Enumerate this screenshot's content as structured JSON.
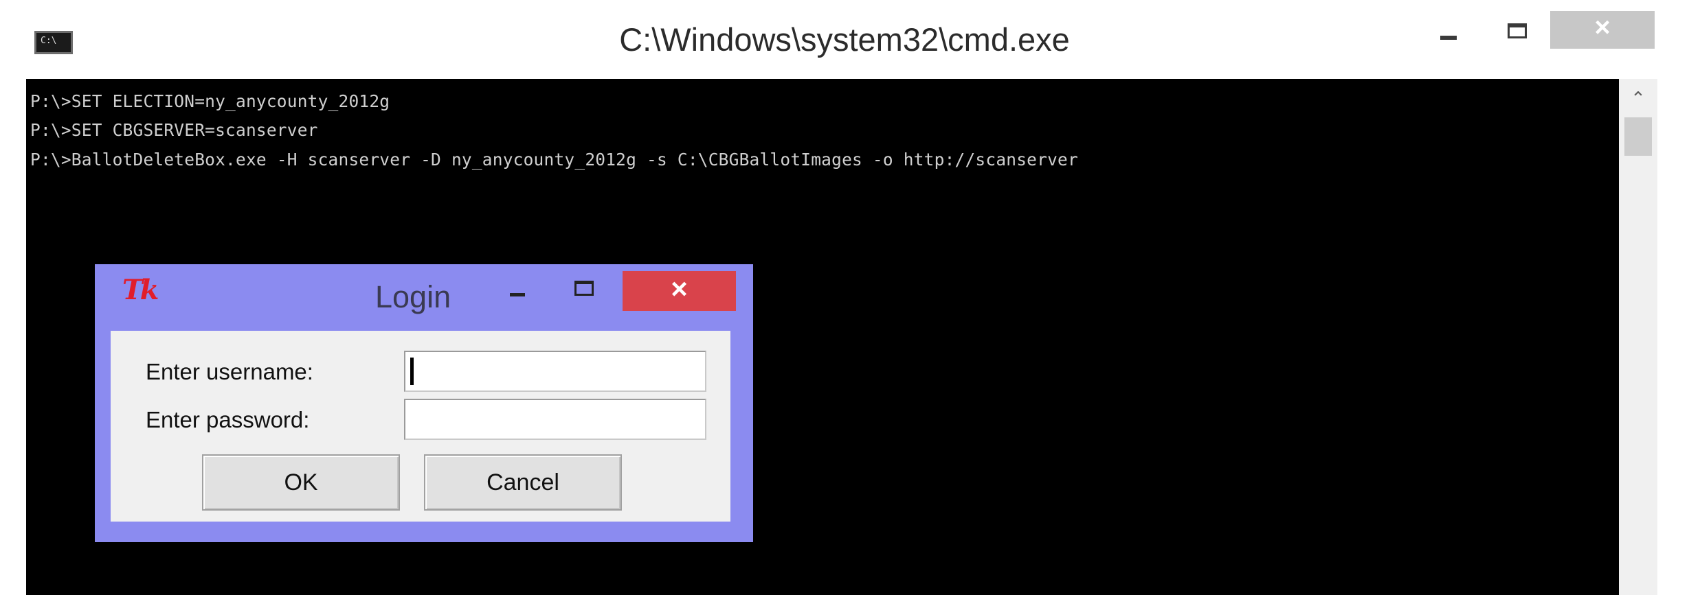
{
  "cmd": {
    "title": "C:\\Windows\\system32\\cmd.exe",
    "icon_text": "C:\\",
    "icon_name": "console-app-icon",
    "close_symbol": "×",
    "scroll_up_symbol": "⌃",
    "lines": [
      "P:\\>SET ELECTION=ny_anycounty_2012g",
      "P:\\>SET CBGSERVER=scanserver",
      "P:\\>BallotDeleteBox.exe -H scanserver -D ny_anycounty_2012g -s C:\\CBGBallotImages -o http://scanserver"
    ]
  },
  "login": {
    "logo": "Tk",
    "title": "Login",
    "close_symbol": "×",
    "username_label": "Enter username:",
    "username_value": "",
    "password_label": "Enter password:",
    "password_value": "",
    "ok_label": "OK",
    "cancel_label": "Cancel"
  },
  "colors": {
    "console_bg": "#000000",
    "console_text": "#cfcfcf",
    "tk_frame": "#8b8bf0",
    "tk_close": "#d9434b",
    "tk_logo": "#e11d2a"
  }
}
